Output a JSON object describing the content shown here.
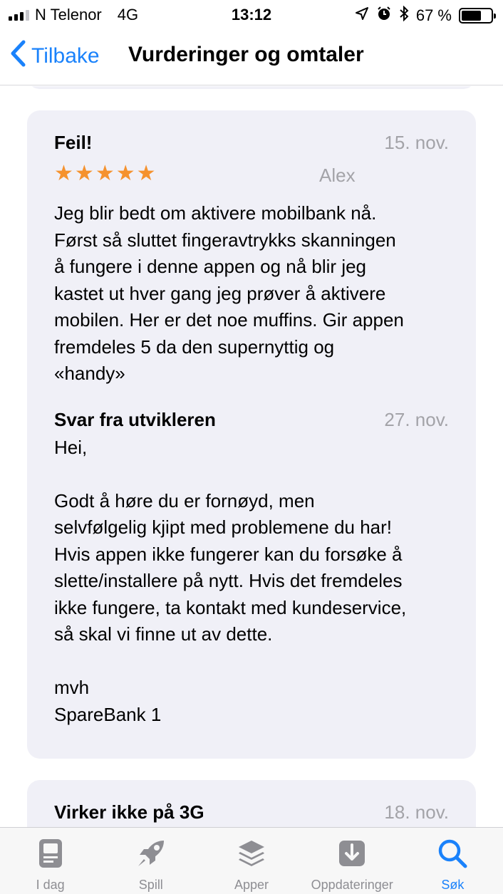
{
  "status_bar": {
    "carrier": "N Telenor",
    "network": "4G",
    "time": "13:12",
    "battery": "67 %",
    "battery_level": 0.67
  },
  "nav": {
    "back_label": "Tilbake",
    "title": "Vurderinger og omtaler"
  },
  "reviews": [
    {
      "title": "Feil!",
      "date": "15. nov.",
      "author": "Alex",
      "stars": 5,
      "body": "Jeg blir bedt om aktivere mobilbank nå.\nFørst så sluttet fingeravtrykks skanningen\nå fungere i denne appen og nå blir jeg\nkastet ut hver gang jeg prøver å aktivere\nmobilen. Her er det noe muffins. Gir appen\nfremdeles 5 da den supernyttig og\n«handy»",
      "developer_response": {
        "title": "Svar fra utvikleren",
        "date": "27. nov.",
        "body": "Hei,\n\nGodt å høre du er fornøyd, men\nselvfølgelig kjipt med problemene du har!\nHvis appen ikke fungerer kan du forsøke å\nslette/installere på nytt. Hvis det fremdeles\nikke fungere, ta kontakt med kundeservice,\nså skal vi finne ut av dette.\n\nmvh\nSpareBank 1"
      }
    },
    {
      "title": "Virker ikke på 3G",
      "date": "18. nov."
    }
  ],
  "tab_bar": {
    "tabs": [
      {
        "label": "I dag",
        "icon": "today-icon"
      },
      {
        "label": "Spill",
        "icon": "rocket-icon"
      },
      {
        "label": "Apper",
        "icon": "layers-icon"
      },
      {
        "label": "Oppdateringer",
        "icon": "download-icon"
      },
      {
        "label": "Søk",
        "icon": "search-icon",
        "active": true
      }
    ]
  },
  "colors": {
    "accent": "#1a82fb",
    "star": "#f5922e",
    "card_bg": "#f0f0f7",
    "secondary_text": "#a3a3a8"
  }
}
